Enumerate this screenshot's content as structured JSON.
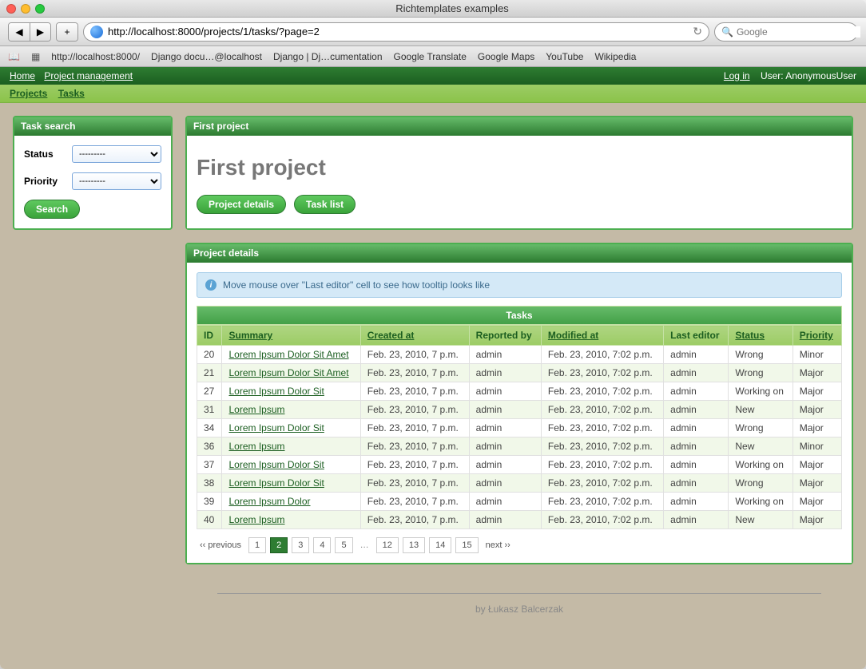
{
  "window_title": "Richtemplates examples",
  "url": "http://localhost:8000/projects/1/tasks/?page=2",
  "search_placeholder": "Google",
  "bookmarks": [
    "http://localhost:8000/",
    "Django docu…@localhost",
    "Django | Dj…cumentation",
    "Google Translate",
    "Google Maps",
    "YouTube",
    "Wikipedia"
  ],
  "topnav": {
    "home": "Home",
    "pm": "Project management",
    "login": "Log in",
    "user_label": "User:",
    "user_value": "AnonymousUser"
  },
  "subnav": {
    "projects": "Projects",
    "tasks": "Tasks"
  },
  "sidebar": {
    "title": "Task search",
    "status_label": "Status",
    "priority_label": "Priority",
    "placeholder": "---------",
    "search_btn": "Search"
  },
  "project_panel": {
    "header": "First project",
    "title": "First project",
    "details_btn": "Project details",
    "tasklist_btn": "Task list"
  },
  "details_panel": {
    "header": "Project details",
    "info_text": "Move mouse over \"Last editor\" cell to see how tooltip looks like",
    "table_caption": "Tasks",
    "columns": {
      "id": "ID",
      "summary": "Summary",
      "created": "Created at",
      "reported": "Reported by",
      "modified": "Modified at",
      "editor": "Last editor",
      "status": "Status",
      "priority": "Priority"
    },
    "rows": [
      {
        "id": "20",
        "summary": "Lorem Ipsum Dolor Sit Amet",
        "created": "Feb. 23, 2010, 7 p.m.",
        "reported": "admin",
        "modified": "Feb. 23, 2010, 7:02 p.m.",
        "editor": "admin",
        "status": "Wrong",
        "priority": "Minor"
      },
      {
        "id": "21",
        "summary": "Lorem Ipsum Dolor Sit Amet",
        "created": "Feb. 23, 2010, 7 p.m.",
        "reported": "admin",
        "modified": "Feb. 23, 2010, 7:02 p.m.",
        "editor": "admin",
        "status": "Wrong",
        "priority": "Major"
      },
      {
        "id": "27",
        "summary": "Lorem Ipsum Dolor Sit",
        "created": "Feb. 23, 2010, 7 p.m.",
        "reported": "admin",
        "modified": "Feb. 23, 2010, 7:02 p.m.",
        "editor": "admin",
        "status": "Working on",
        "priority": "Major"
      },
      {
        "id": "31",
        "summary": "Lorem Ipsum",
        "created": "Feb. 23, 2010, 7 p.m.",
        "reported": "admin",
        "modified": "Feb. 23, 2010, 7:02 p.m.",
        "editor": "admin",
        "status": "New",
        "priority": "Major"
      },
      {
        "id": "34",
        "summary": "Lorem Ipsum Dolor Sit",
        "created": "Feb. 23, 2010, 7 p.m.",
        "reported": "admin",
        "modified": "Feb. 23, 2010, 7:02 p.m.",
        "editor": "admin",
        "status": "Wrong",
        "priority": "Major"
      },
      {
        "id": "36",
        "summary": "Lorem Ipsum",
        "created": "Feb. 23, 2010, 7 p.m.",
        "reported": "admin",
        "modified": "Feb. 23, 2010, 7:02 p.m.",
        "editor": "admin",
        "status": "New",
        "priority": "Minor"
      },
      {
        "id": "37",
        "summary": "Lorem Ipsum Dolor Sit",
        "created": "Feb. 23, 2010, 7 p.m.",
        "reported": "admin",
        "modified": "Feb. 23, 2010, 7:02 p.m.",
        "editor": "admin",
        "status": "Working on",
        "priority": "Major"
      },
      {
        "id": "38",
        "summary": "Lorem Ipsum Dolor Sit",
        "created": "Feb. 23, 2010, 7 p.m.",
        "reported": "admin",
        "modified": "Feb. 23, 2010, 7:02 p.m.",
        "editor": "admin",
        "status": "Wrong",
        "priority": "Major"
      },
      {
        "id": "39",
        "summary": "Lorem Ipsum Dolor",
        "created": "Feb. 23, 2010, 7 p.m.",
        "reported": "admin",
        "modified": "Feb. 23, 2010, 7:02 p.m.",
        "editor": "admin",
        "status": "Working on",
        "priority": "Major"
      },
      {
        "id": "40",
        "summary": "Lorem Ipsum",
        "created": "Feb. 23, 2010, 7 p.m.",
        "reported": "admin",
        "modified": "Feb. 23, 2010, 7:02 p.m.",
        "editor": "admin",
        "status": "New",
        "priority": "Major"
      }
    ],
    "pagination": {
      "prev": "‹‹ previous",
      "pages_a": [
        "1",
        "2",
        "3",
        "4",
        "5"
      ],
      "pages_b": [
        "12",
        "13",
        "14",
        "15"
      ],
      "active": "2",
      "next": "next ››"
    }
  },
  "footer": "by Łukasz Balcerzak"
}
